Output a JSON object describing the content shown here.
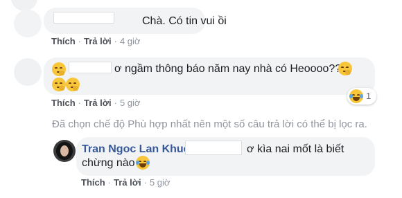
{
  "comments": [
    {
      "text": "Chà. Có tin vui ồi",
      "actions": {
        "like": "Thích",
        "reply": "Trả lời",
        "time": "4 giờ"
      }
    },
    {
      "text": "ơ ngầm thông báo năm nay nhà có Heoooo???",
      "emojis": [
        "thinking-emoji",
        "thinking-emoji",
        "thinking-emoji"
      ],
      "reaction": {
        "icon": "haha-reaction-icon",
        "count": "1"
      },
      "actions": {
        "like": "Thích",
        "reply": "Trả lời",
        "time": "5 giờ"
      }
    }
  ],
  "filter_notice": "Đã chọn chế độ Phù hợp nhất nên một số câu trả lời có thể bị lọc ra.",
  "reply": {
    "author": "Tran Ngoc Lan Khue",
    "text_line1": "ơ kìa nai mốt là biết",
    "text_line2": "chừng nào",
    "emoji": "laughing-emoji",
    "actions": {
      "like": "Thích",
      "reply": "Trả lời",
      "time": "5 giờ"
    }
  },
  "colors": {
    "bubble": "#f2f3f5",
    "author_link": "#385898",
    "meta_text": "#8d949e"
  }
}
